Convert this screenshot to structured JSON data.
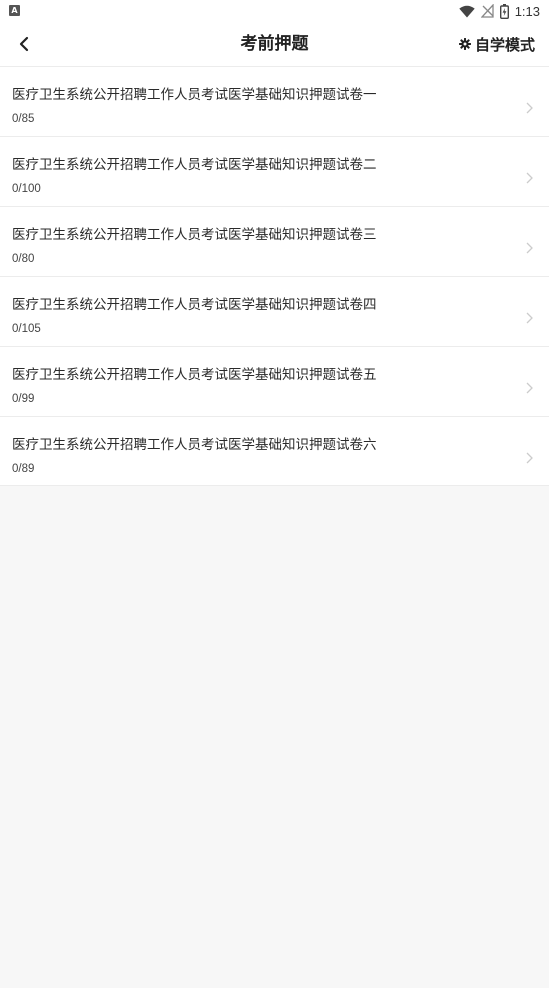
{
  "status_bar": {
    "notification_badge": "A",
    "time": "1:13",
    "icons": [
      "wifi-icon",
      "no-signal-icon",
      "battery-icon"
    ]
  },
  "header": {
    "back_icon": "chevron-left-icon",
    "title": "考前押题",
    "mode_icon": "gear-icon",
    "mode_label": "自学模式"
  },
  "papers": [
    {
      "title": "医疗卫生系统公开招聘工作人员考试医学基础知识押题试卷一",
      "progress": "0/85"
    },
    {
      "title": "医疗卫生系统公开招聘工作人员考试医学基础知识押题试卷二",
      "progress": "0/100"
    },
    {
      "title": "医疗卫生系统公开招聘工作人员考试医学基础知识押题试卷三",
      "progress": "0/80"
    },
    {
      "title": "医疗卫生系统公开招聘工作人员考试医学基础知识押题试卷四",
      "progress": "0/105"
    },
    {
      "title": "医疗卫生系统公开招聘工作人员考试医学基础知识押题试卷五",
      "progress": "0/99"
    },
    {
      "title": "医疗卫生系统公开招聘工作人员考试医学基础知识押题试卷六",
      "progress": "0/89"
    }
  ],
  "colors": {
    "background": "#f7f7f7",
    "surface": "#ffffff",
    "text": "#222222",
    "chevron": "#cccccc"
  }
}
